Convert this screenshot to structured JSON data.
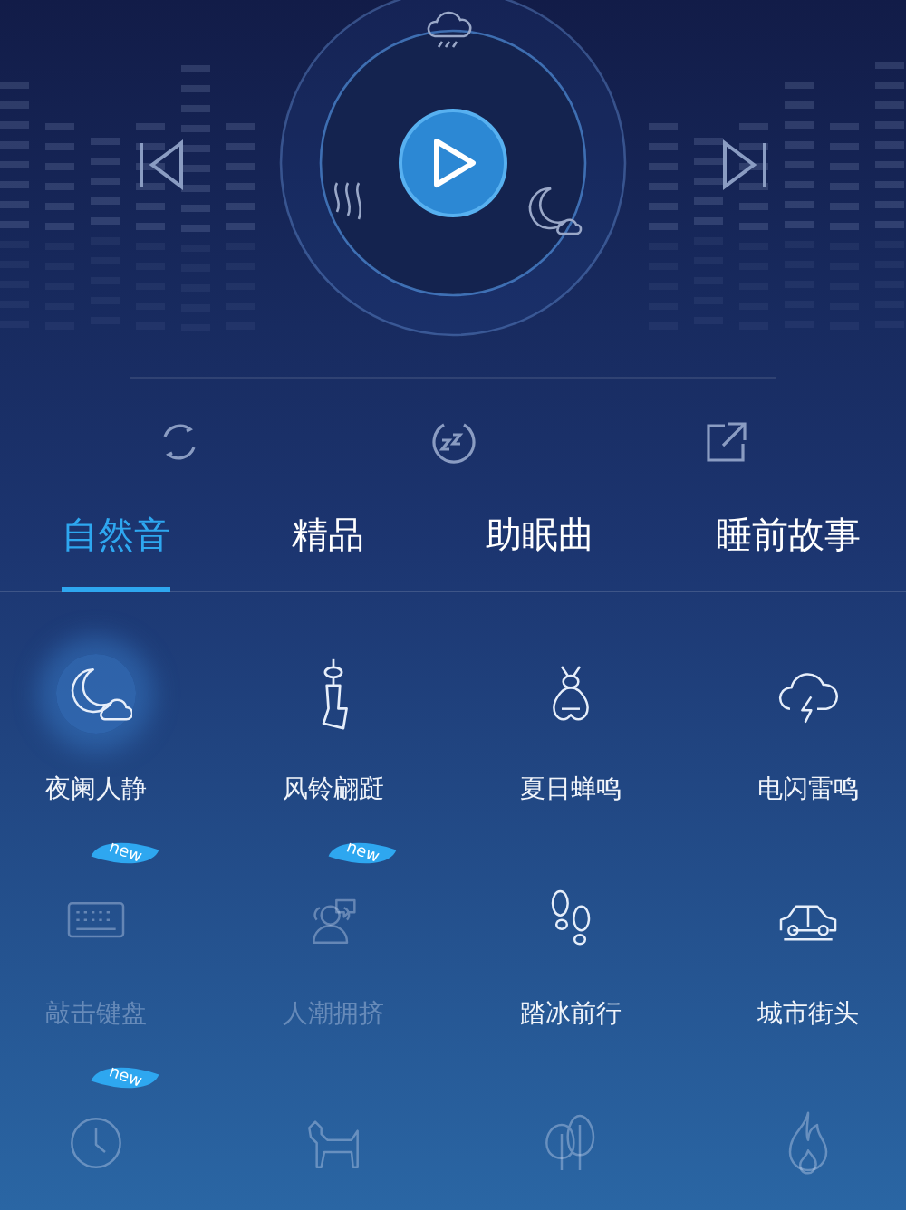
{
  "tabs": [
    {
      "label": "自然音",
      "selected": true
    },
    {
      "label": "精品",
      "selected": false
    },
    {
      "label": "助眠曲",
      "selected": false
    },
    {
      "label": "睡前故事",
      "selected": false
    }
  ],
  "sounds": [
    {
      "label": "夜阑人静",
      "selected": true,
      "dimmed": false
    },
    {
      "label": "风铃翩跹",
      "selected": false,
      "dimmed": false
    },
    {
      "label": "夏日蝉鸣",
      "selected": false,
      "dimmed": false
    },
    {
      "label": "电闪雷鸣",
      "selected": false,
      "dimmed": false
    },
    {
      "label": "敲击键盘",
      "selected": false,
      "dimmed": true,
      "badge": "new"
    },
    {
      "label": "人潮拥挤",
      "selected": false,
      "dimmed": true,
      "badge": "new"
    },
    {
      "label": "踏冰前行",
      "selected": false,
      "dimmed": false
    },
    {
      "label": "城市街头",
      "selected": false,
      "dimmed": false
    },
    {
      "selected": false,
      "dimmed": true,
      "badge": "new"
    },
    {
      "selected": false,
      "dimmed": true
    },
    {
      "selected": false,
      "dimmed": true
    },
    {
      "selected": false,
      "dimmed": true
    }
  ]
}
